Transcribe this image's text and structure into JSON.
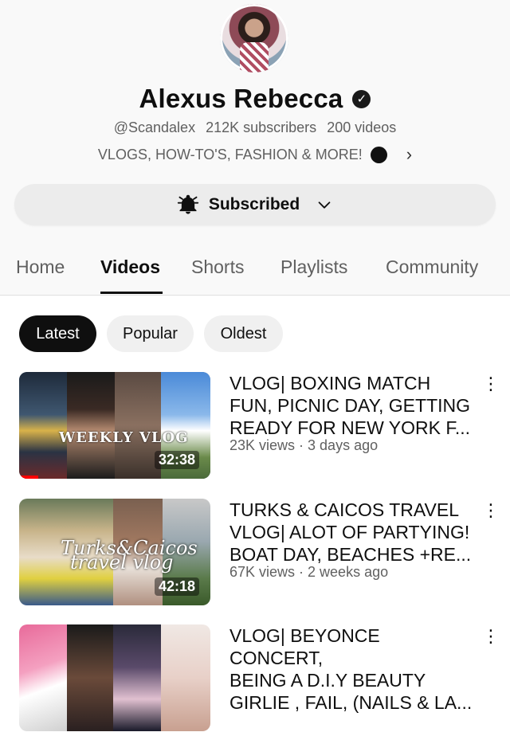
{
  "channel": {
    "name": "Alexus Rebecca",
    "handle": "@Scandalex",
    "subscribers": "212K subscribers",
    "videos_count": "200 videos",
    "description": "VLOGS, HOW-TO'S, FASHION & MORE!",
    "verified": true
  },
  "subscribe": {
    "label": "Subscribed",
    "icon": "bell-icon"
  },
  "tabs": [
    {
      "label": "Home"
    },
    {
      "label": "Videos",
      "active": true
    },
    {
      "label": "Shorts"
    },
    {
      "label": "Playlists"
    },
    {
      "label": "Community"
    }
  ],
  "chips": [
    {
      "label": "Latest",
      "selected": true
    },
    {
      "label": "Popular"
    },
    {
      "label": "Oldest"
    }
  ],
  "videos": [
    {
      "title_lines": [
        "VLOG| BOXING MATCH",
        "FUN, PICNIC DAY, GETTING",
        "READY FOR NEW YORK F..."
      ],
      "meta": "23K views · 3 days ago",
      "duration": "32:38",
      "thumb_text": "WEEKLY VLOG",
      "watched_fraction": 0.1
    },
    {
      "title_lines": [
        "TURKS & CAICOS TRAVEL",
        "VLOG| ALOT OF PARTYING!",
        "BOAT DAY, BEACHES +RE..."
      ],
      "meta": "67K views · 2 weeks ago",
      "duration": "42:18",
      "thumb_text": "Turks&Caicos",
      "thumb_text_2": "travel vlog"
    },
    {
      "title_lines": [
        "VLOG| BEYONCE CONCERT,",
        "BEING A D.I.Y BEAUTY",
        "GIRLIE , FAIL, (NAILS & LA..."
      ]
    }
  ]
}
